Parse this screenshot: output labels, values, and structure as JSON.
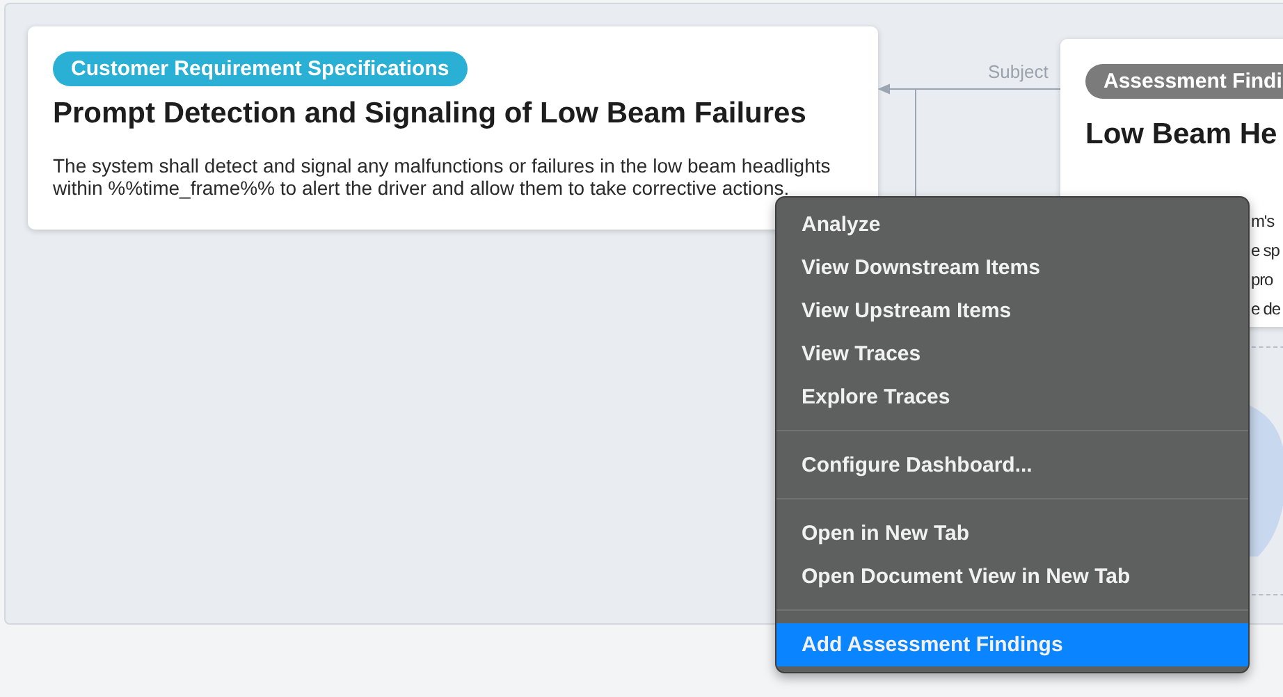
{
  "left_card": {
    "tag": "Customer Requirement Specifications",
    "title": "Prompt Detection and Signaling of Low Beam Failures",
    "body": "The system shall detect and signal any malfunctions or failures in the low beam headlights within %%time_frame%% to alert the driver and allow them to take corrective actions."
  },
  "link": {
    "label": "Subject"
  },
  "right_card": {
    "tag": "Assessment Findi",
    "title": "Low Beam He",
    "body_lines": [
      "m's",
      "e sp",
      "pro",
      "e de"
    ]
  },
  "context_menu": {
    "groups": [
      [
        {
          "label": "Analyze",
          "selected": false
        },
        {
          "label": "View Downstream Items",
          "selected": false
        },
        {
          "label": "View Upstream Items",
          "selected": false
        },
        {
          "label": "View Traces",
          "selected": false
        },
        {
          "label": "Explore Traces",
          "selected": false
        }
      ],
      [
        {
          "label": "Configure Dashboard...",
          "selected": false
        }
      ],
      [
        {
          "label": "Open in New Tab",
          "selected": false
        },
        {
          "label": "Open Document View in New Tab",
          "selected": false
        }
      ],
      [
        {
          "label": "Add Assessment Findings",
          "selected": true
        }
      ]
    ]
  }
}
